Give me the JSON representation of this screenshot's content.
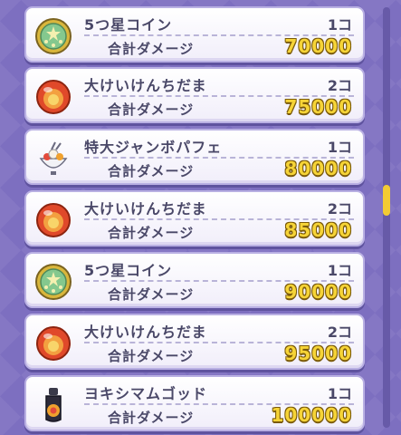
{
  "damage_label": "合計ダメージ",
  "items": [
    {
      "name": "5つ星コイン",
      "count": "1コ",
      "damage": "70000",
      "icon": "five-star-coin"
    },
    {
      "name": "大けいけんちだま",
      "count": "2コ",
      "damage": "75000",
      "icon": "exp-orb"
    },
    {
      "name": "特大ジャンボパフェ",
      "count": "1コ",
      "damage": "80000",
      "icon": "jumbo-parfait"
    },
    {
      "name": "大けいけんちだま",
      "count": "2コ",
      "damage": "85000",
      "icon": "exp-orb"
    },
    {
      "name": "5つ星コイン",
      "count": "1コ",
      "damage": "90000",
      "icon": "five-star-coin"
    },
    {
      "name": "大けいけんちだま",
      "count": "2コ",
      "damage": "95000",
      "icon": "exp-orb"
    },
    {
      "name": "ヨキシマムゴッド",
      "count": "1コ",
      "damage": "100000",
      "icon": "yokishimamu-god-bottle"
    }
  ]
}
